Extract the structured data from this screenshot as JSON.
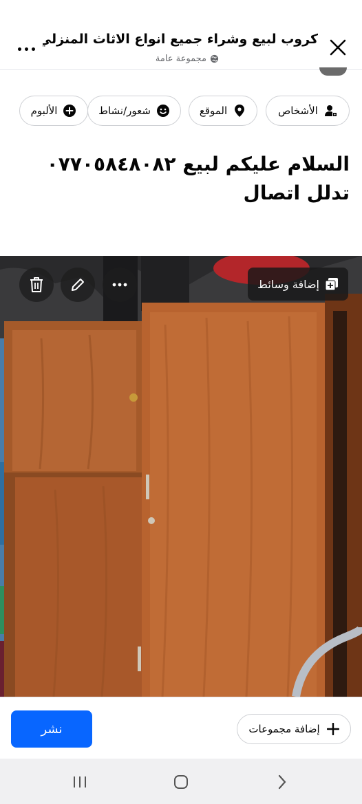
{
  "header": {
    "title": "كروب لبيع وشراء جميع انواع الاثاث المنزلي في...",
    "subtitle": "مجموعة عامة",
    "close_icon": "close-icon",
    "more_icon": "more-options-icon",
    "globe_icon": "globe-icon"
  },
  "chips": [
    {
      "label": "الأشخاص",
      "icon": "tag-people-icon"
    },
    {
      "label": "الموقع",
      "icon": "location-pin-icon"
    },
    {
      "label": "شعور/نشاط",
      "icon": "smiley-icon"
    },
    {
      "label": "الألبوم",
      "icon": "plus-circle-icon"
    }
  ],
  "post": {
    "text": "السلام عليكم لبيع ٠٧٧٠٥٨٤٨٠٨٢ تدلل اتصال"
  },
  "photo": {
    "add_media_label": "إضافة وسائط",
    "subject": "wooden-wardrobe-photo",
    "overlay_icons": [
      "trash-icon",
      "edit-pencil-icon",
      "more-options-icon",
      "add-media-icon"
    ]
  },
  "footer": {
    "publish_label": "نشر",
    "add_groups_label": "إضافة مجموعات",
    "publish_color": "#0866ff"
  },
  "navbar": {
    "icons": [
      "recents-icon",
      "home-icon",
      "back-icon"
    ]
  }
}
